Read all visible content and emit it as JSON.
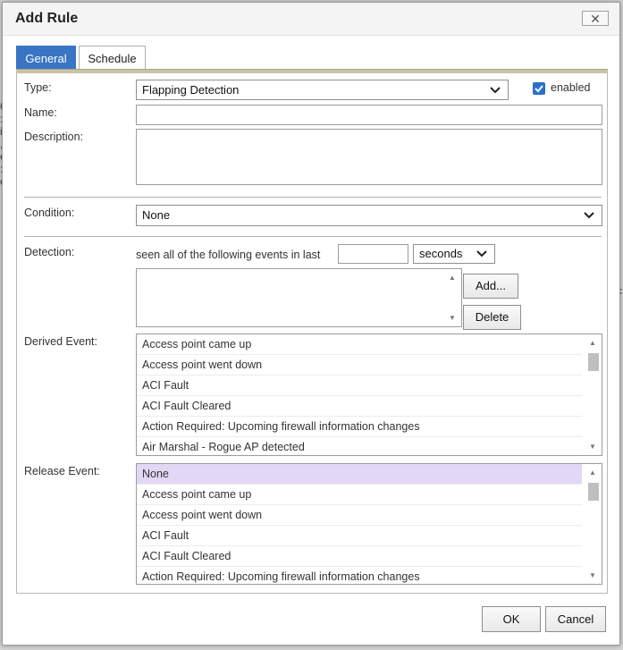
{
  "dialog": {
    "title": "Add Rule",
    "close_label": "✕"
  },
  "tabs": [
    {
      "label": "General",
      "active": true
    },
    {
      "label": "Schedule",
      "active": false
    }
  ],
  "form": {
    "type_label": "Type:",
    "type_value": "Flapping Detection",
    "enabled_label": "enabled",
    "enabled_checked": true,
    "name_label": "Name:",
    "name_value": "",
    "description_label": "Description:",
    "description_value": "",
    "condition_label": "Condition:",
    "condition_value": "None",
    "detection_label": "Detection:",
    "detection_text": "seen all of the following events in last",
    "detection_time_value": "",
    "detection_unit": "seconds",
    "add_button": "Add...",
    "delete_button": "Delete",
    "derived_label": "Derived Event:",
    "derived_items": [
      "Access point came up",
      "Access point went down",
      "ACI Fault",
      "ACI Fault Cleared",
      "Action Required: Upcoming firewall information changes",
      "Air Marshal - Rogue AP detected"
    ],
    "release_label": "Release Event:",
    "release_items": [
      "None",
      "Access point came up",
      "Access point went down",
      "ACI Fault",
      "ACI Fault Cleared",
      "Action Required: Upcoming firewall information changes"
    ],
    "release_selected_index": 0
  },
  "footer": {
    "ok_label": "OK",
    "cancel_label": "Cancel"
  },
  "colors": {
    "tab_active": "#3a74c4",
    "checkbox": "#2c6ecb",
    "selected_row": "#e3d7f6"
  }
}
